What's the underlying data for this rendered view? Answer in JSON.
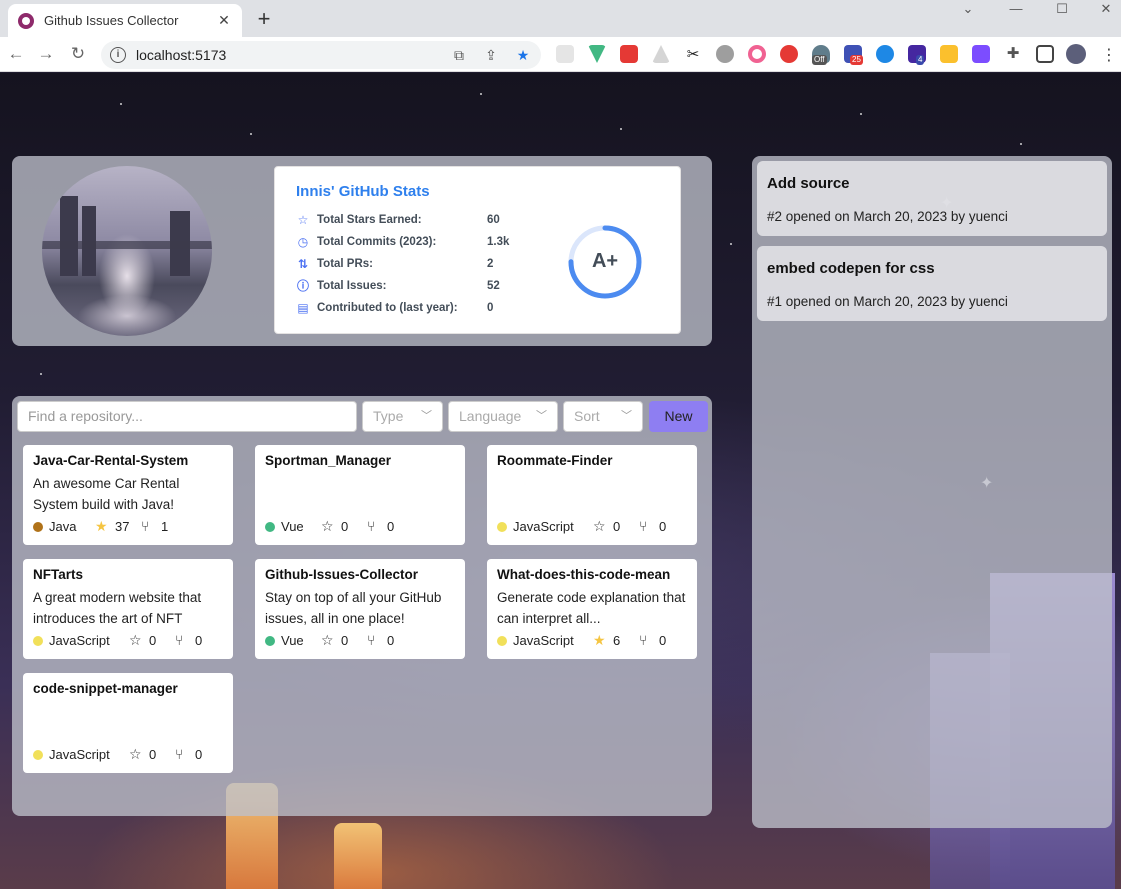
{
  "browser": {
    "tab_title": "Github Issues Collector",
    "url": "localhost:5173",
    "ext_badges": {
      "off": "Off",
      "count1": "25",
      "count2": "4"
    }
  },
  "stats": {
    "title": "Innis' GitHub Stats",
    "rows": [
      {
        "label": "Total Stars Earned:",
        "value": "60",
        "icon": "star-icon"
      },
      {
        "label": "Total Commits (2023):",
        "value": "1.3k",
        "icon": "clock-icon"
      },
      {
        "label": "Total PRs:",
        "value": "2",
        "icon": "pull-request-icon"
      },
      {
        "label": "Total Issues:",
        "value": "52",
        "icon": "issue-icon"
      },
      {
        "label": "Contributed to (last year):",
        "value": "0",
        "icon": "repo-icon"
      }
    ],
    "grade": "A+",
    "grade_progress": 0.75
  },
  "toolbar": {
    "search_placeholder": "Find a repository...",
    "type_label": "Type",
    "language_label": "Language",
    "sort_label": "Sort",
    "new_label": "New"
  },
  "repos": [
    {
      "name": "Java-Car-Rental-System",
      "desc": "An awesome Car Rental System build with Java!",
      "lang": "Java",
      "lang_color": "#b07219",
      "stars": "37",
      "forks": "1",
      "starred": true
    },
    {
      "name": "Sportman_Manager",
      "desc": "",
      "lang": "Vue",
      "lang_color": "#41b883",
      "stars": "0",
      "forks": "0",
      "starred": false
    },
    {
      "name": "Roommate-Finder",
      "desc": "",
      "lang": "JavaScript",
      "lang_color": "#f1e05a",
      "stars": "0",
      "forks": "0",
      "starred": false
    },
    {
      "name": "NFTarts",
      "desc": "A great modern website that introduces the art of NFT",
      "lang": "JavaScript",
      "lang_color": "#f1e05a",
      "stars": "0",
      "forks": "0",
      "starred": false
    },
    {
      "name": "Github-Issues-Collector",
      "desc": "Stay on top of all your GitHub issues, all in one place!",
      "lang": "Vue",
      "lang_color": "#41b883",
      "stars": "0",
      "forks": "0",
      "starred": false
    },
    {
      "name": "What-does-this-code-mean",
      "desc": "Generate code explanation that can interpret all...",
      "lang": "JavaScript",
      "lang_color": "#f1e05a",
      "stars": "6",
      "forks": "0",
      "starred": true
    },
    {
      "name": "code-snippet-manager",
      "desc": "",
      "lang": "JavaScript",
      "lang_color": "#f1e05a",
      "stars": "0",
      "forks": "0",
      "starred": false
    }
  ],
  "issues": [
    {
      "title": "Add source",
      "subtitle": "#2 opened on March 20, 2023 by yuenci"
    },
    {
      "title": "embed codepen for css",
      "subtitle": "#1 opened on March 20, 2023 by yuenci"
    }
  ]
}
